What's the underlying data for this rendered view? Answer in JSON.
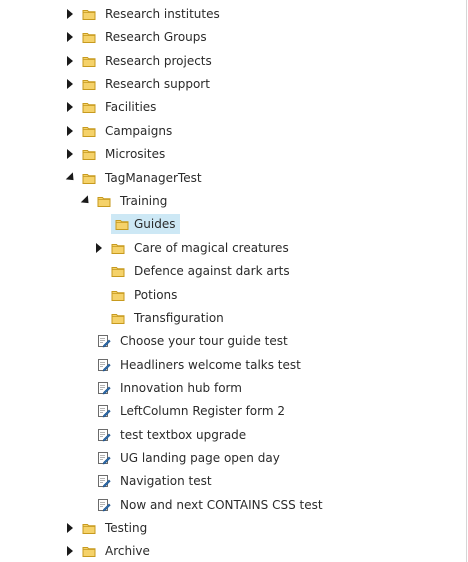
{
  "tree": {
    "items": [
      {
        "label": "Research institutes",
        "type": "folder",
        "expanded": false
      },
      {
        "label": "Research Groups",
        "type": "folder",
        "expanded": false
      },
      {
        "label": "Research projects",
        "type": "folder",
        "expanded": false
      },
      {
        "label": "Research support",
        "type": "folder",
        "expanded": false
      },
      {
        "label": "Facilities",
        "type": "folder",
        "expanded": false
      },
      {
        "label": "Campaigns",
        "type": "folder",
        "expanded": false
      },
      {
        "label": "Microsites",
        "type": "folder",
        "expanded": false
      },
      {
        "label": "TagManagerTest",
        "type": "folder",
        "expanded": true
      },
      {
        "label": "Training",
        "type": "folder",
        "expanded": true
      },
      {
        "label": "Guides",
        "type": "folder",
        "selected": true
      },
      {
        "label": "Care of magical creatures",
        "type": "folder",
        "expanded": false
      },
      {
        "label": "Defence against dark arts",
        "type": "folder"
      },
      {
        "label": "Potions",
        "type": "folder"
      },
      {
        "label": "Transfiguration",
        "type": "folder"
      },
      {
        "label": "Choose your tour guide test",
        "type": "document"
      },
      {
        "label": "Headliners welcome talks test",
        "type": "document"
      },
      {
        "label": "Innovation hub form",
        "type": "document"
      },
      {
        "label": "LeftColumn Register form 2",
        "type": "document"
      },
      {
        "label": "test textbox upgrade",
        "type": "document"
      },
      {
        "label": "UG landing page open day",
        "type": "document"
      },
      {
        "label": "Navigation test",
        "type": "document"
      },
      {
        "label": "Now and next CONTAINS CSS test",
        "type": "document"
      },
      {
        "label": "Testing",
        "type": "folder",
        "expanded": false
      },
      {
        "label": "Archive",
        "type": "folder",
        "expanded": false
      }
    ]
  },
  "colors": {
    "folder_fill": "#f5d26a",
    "folder_stroke": "#c79a1e",
    "document_fill": "#ffffff",
    "document_stroke": "#6b6b6b",
    "pencil": "#2f6fb0",
    "selection": "#cde8f5"
  }
}
